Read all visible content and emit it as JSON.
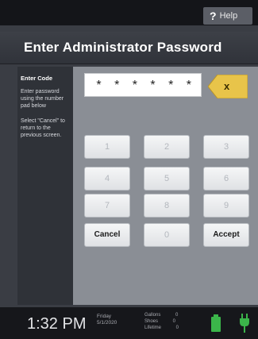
{
  "topbar": {
    "help_label": "Help",
    "help_symbol": "?"
  },
  "title": "Enter Administrator Password",
  "side": {
    "header": "Enter Code",
    "p1": "Enter password using the number pad below",
    "p2": "Select \"Cancel\" to return to the previous screen."
  },
  "password_display": "* * * * * *",
  "clear_label": "x",
  "keypad": {
    "k1": "1",
    "k2": "2",
    "k3": "3",
    "k4": "4",
    "k5": "5",
    "k6": "6",
    "k7": "7",
    "k8": "8",
    "k9": "9",
    "cancel": "Cancel",
    "k0": "0",
    "accept": "Accept"
  },
  "status": {
    "time": "1:32 PM",
    "day": "Friday",
    "date": "5/1/2020",
    "rows": [
      {
        "label": "Gallons",
        "value": "0"
      },
      {
        "label": "Shoes",
        "value": "0"
      },
      {
        "label": "Lifetime",
        "value": "0"
      }
    ]
  },
  "colors": {
    "clear_button": "#e8c44a",
    "battery": "#3bb54a",
    "plug": "#3bb54a"
  },
  "icons": [
    "help-icon",
    "battery-icon",
    "plug-icon"
  ]
}
